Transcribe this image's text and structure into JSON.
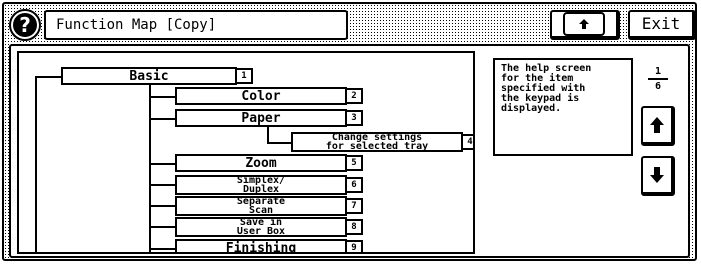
{
  "header": {
    "help_icon_glyph": "?",
    "title": "Function Map [Copy]",
    "exit_label": "Exit"
  },
  "help_text": "The help screen\nfor the item\nspecified with\nthe keypad is\ndisplayed.",
  "page": {
    "current": "1",
    "total": "6"
  },
  "tree": [
    {
      "label": "Basic",
      "number": "1"
    },
    {
      "label": "Color",
      "number": "2"
    },
    {
      "label": "Paper",
      "number": "3"
    },
    {
      "label_lines": [
        "Change settings",
        "for selected tray"
      ],
      "number": "4"
    },
    {
      "label": "Zoom",
      "number": "5"
    },
    {
      "label_lines": [
        "Simplex/",
        "Duplex"
      ],
      "number": "6"
    },
    {
      "label_lines": [
        "Separate",
        "Scan"
      ],
      "number": "7"
    },
    {
      "label_lines": [
        "Save in",
        "User Box"
      ],
      "number": "8"
    },
    {
      "label": "Finishing",
      "number": "9"
    }
  ],
  "colors": {
    "foreground": "#000000",
    "background": "#ffffff"
  }
}
